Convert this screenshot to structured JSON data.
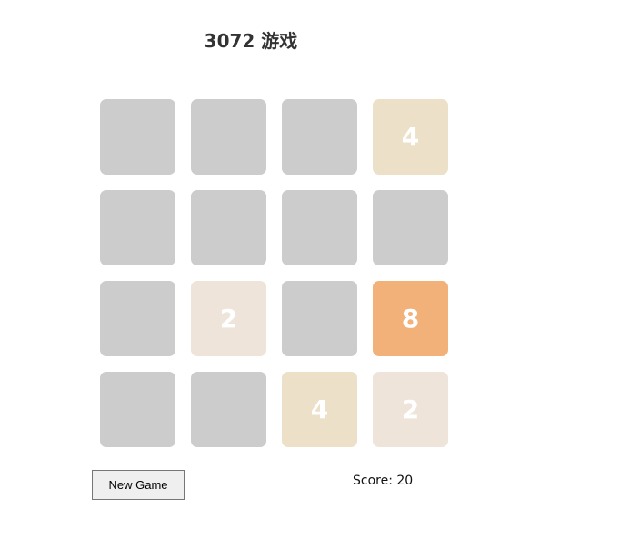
{
  "game": {
    "title": "3072 游戏"
  },
  "board": {
    "size": 4,
    "tiles": [
      [
        null,
        null,
        null,
        4
      ],
      [
        null,
        null,
        null,
        null
      ],
      [
        null,
        2,
        null,
        8
      ],
      [
        null,
        null,
        4,
        2
      ]
    ]
  },
  "tile_colors": {
    "empty": "#cccccc",
    "2": "#eee4da",
    "4": "#ede0c8",
    "8": "#f2b179"
  },
  "controls": {
    "new_game_label": "New Game"
  },
  "score": {
    "label": "Score: ",
    "value": 20
  }
}
